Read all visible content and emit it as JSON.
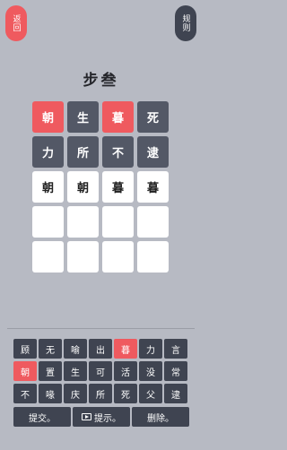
{
  "header": {
    "back_label": "返回",
    "rules_label": "规则"
  },
  "title": "步叁",
  "colors": {
    "background": "#b7bac3",
    "accent_red": "#ef5a5f",
    "dark_tile": "#535866",
    "key_dark": "#3f4451"
  },
  "grid": {
    "rows": [
      [
        {
          "char": "朝",
          "state": "red"
        },
        {
          "char": "生",
          "state": "dark"
        },
        {
          "char": "暮",
          "state": "red"
        },
        {
          "char": "死",
          "state": "dark"
        }
      ],
      [
        {
          "char": "力",
          "state": "dark"
        },
        {
          "char": "所",
          "state": "dark"
        },
        {
          "char": "不",
          "state": "dark"
        },
        {
          "char": "逮",
          "state": "dark"
        }
      ],
      [
        {
          "char": "朝",
          "state": "white"
        },
        {
          "char": "朝",
          "state": "white"
        },
        {
          "char": "暮",
          "state": "white"
        },
        {
          "char": "暮",
          "state": "white"
        }
      ],
      [
        {
          "char": "",
          "state": "white"
        },
        {
          "char": "",
          "state": "white"
        },
        {
          "char": "",
          "state": "white"
        },
        {
          "char": "",
          "state": "white"
        }
      ],
      [
        {
          "char": "",
          "state": "white"
        },
        {
          "char": "",
          "state": "white"
        },
        {
          "char": "",
          "state": "white"
        },
        {
          "char": "",
          "state": "white"
        }
      ]
    ]
  },
  "keyboard": {
    "rows": [
      [
        {
          "char": "顾",
          "state": "dark"
        },
        {
          "char": "无",
          "state": "dark"
        },
        {
          "char": "喻",
          "state": "dark"
        },
        {
          "char": "出",
          "state": "dark"
        },
        {
          "char": "暮",
          "state": "red"
        },
        {
          "char": "力",
          "state": "dark"
        },
        {
          "char": "言",
          "state": "dark"
        }
      ],
      [
        {
          "char": "朝",
          "state": "red"
        },
        {
          "char": "置",
          "state": "dark"
        },
        {
          "char": "生",
          "state": "dark"
        },
        {
          "char": "可",
          "state": "dark"
        },
        {
          "char": "活",
          "state": "dark"
        },
        {
          "char": "没",
          "state": "dark"
        },
        {
          "char": "常",
          "state": "dark"
        }
      ],
      [
        {
          "char": "不",
          "state": "dark"
        },
        {
          "char": "喙",
          "state": "dark"
        },
        {
          "char": "庆",
          "state": "dark"
        },
        {
          "char": "所",
          "state": "dark"
        },
        {
          "char": "死",
          "state": "dark"
        },
        {
          "char": "父",
          "state": "dark"
        },
        {
          "char": "逮",
          "state": "dark"
        }
      ]
    ]
  },
  "actions": {
    "submit_label": "提交。",
    "hint_label": "提示。",
    "delete_label": "删除。",
    "hint_icon": "video-play-icon"
  }
}
